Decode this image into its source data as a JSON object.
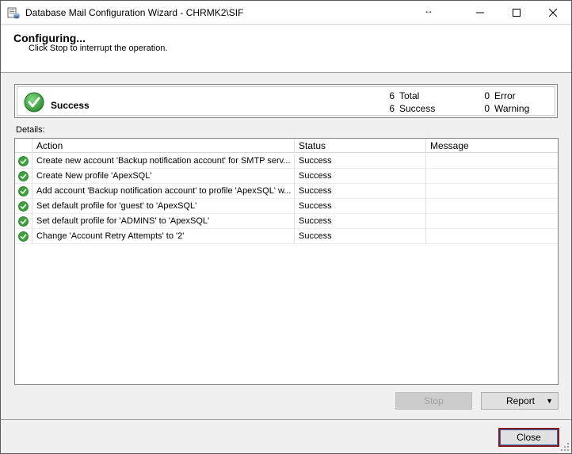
{
  "window": {
    "title": "Database Mail Configuration Wizard - CHRMK2\\SIF",
    "icon": "database-mail-icon",
    "controls": [
      "minimize-icon",
      "maximize-icon",
      "close-icon"
    ]
  },
  "header": {
    "title": "Configuring...",
    "subtitle": "Click Stop to interrupt the operation."
  },
  "summary": {
    "result": "Success",
    "total_count": "6",
    "total_label": "Total",
    "success_count": "6",
    "success_label": "Success",
    "error_count": "0",
    "error_label": "Error",
    "warning_count": "0",
    "warning_label": "Warning",
    "status_color": "#3aa33a"
  },
  "details": {
    "label": "Details:",
    "columns": [
      "Action",
      "Status",
      "Message"
    ],
    "rows": [
      {
        "action": "Create new account 'Backup notification account' for SMTP serv...",
        "status": "Success",
        "message": ""
      },
      {
        "action": "Create New profile 'ApexSQL'",
        "status": "Success",
        "message": ""
      },
      {
        "action": "Add account 'Backup notification account' to profile 'ApexSQL' w...",
        "status": "Success",
        "message": ""
      },
      {
        "action": "Set default profile for 'guest' to 'ApexSQL'",
        "status": "Success",
        "message": ""
      },
      {
        "action": "Set default profile for 'ADMINS' to 'ApexSQL'",
        "status": "Success",
        "message": ""
      },
      {
        "action": "Change 'Account Retry Attempts' to '2'",
        "status": "Success",
        "message": ""
      }
    ]
  },
  "buttons": {
    "stop": "Stop",
    "report": "Report",
    "close": "Close"
  }
}
